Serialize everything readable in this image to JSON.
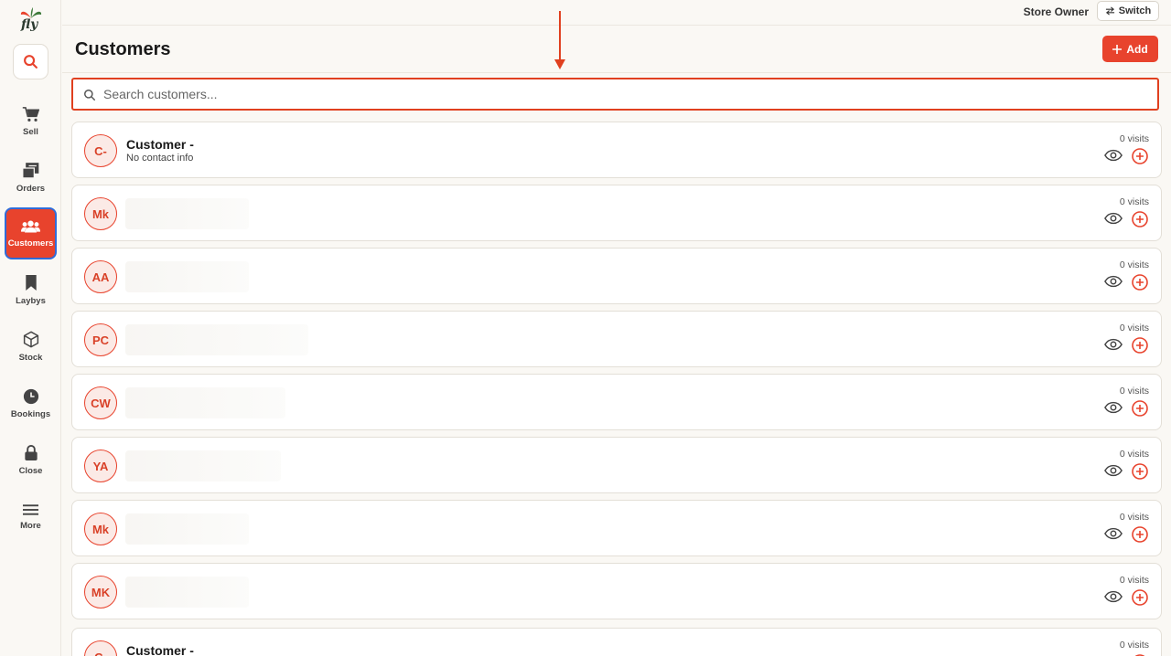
{
  "app": {
    "logo_text": "fly"
  },
  "topbar": {
    "role": "Store Owner",
    "switch_label": "Switch"
  },
  "sidebar": {
    "items": [
      {
        "label": "Sell",
        "icon": "cart-icon",
        "active": false
      },
      {
        "label": "Orders",
        "icon": "orders-icon",
        "active": false
      },
      {
        "label": "Customers",
        "icon": "users-icon",
        "active": true
      },
      {
        "label": "Laybys",
        "icon": "bookmark-icon",
        "active": false
      },
      {
        "label": "Stock",
        "icon": "box-icon",
        "active": false
      },
      {
        "label": "Bookings",
        "icon": "clock-icon",
        "active": false
      },
      {
        "label": "Close",
        "icon": "lock-icon",
        "active": false
      },
      {
        "label": "More",
        "icon": "menu-icon",
        "active": false
      }
    ]
  },
  "header": {
    "title": "Customers",
    "add_label": "Add"
  },
  "search": {
    "placeholder": "Search customers..."
  },
  "customers": [
    {
      "initials": "C-",
      "name": "Customer -",
      "sub": "No contact info",
      "visits": "0 visits"
    },
    {
      "initials": "Mk",
      "name": "",
      "sub": "",
      "visits": "0 visits"
    },
    {
      "initials": "AA",
      "name": "",
      "sub": "",
      "visits": "0 visits"
    },
    {
      "initials": "PC",
      "name": "",
      "sub": "",
      "visits": "0 visits"
    },
    {
      "initials": "CW",
      "name": "",
      "sub": "",
      "visits": "0 visits"
    },
    {
      "initials": "YA",
      "name": "",
      "sub": "",
      "visits": "0 visits"
    },
    {
      "initials": "Mk",
      "name": "",
      "sub": "",
      "visits": "0 visits"
    },
    {
      "initials": "MK",
      "name": "",
      "sub": "",
      "visits": "0 visits"
    },
    {
      "initials": "C-",
      "name": "Customer -",
      "sub": "",
      "visits": "0 visits"
    }
  ],
  "colors": {
    "accent": "#e8432d",
    "active_outline": "#2f6bd8"
  }
}
